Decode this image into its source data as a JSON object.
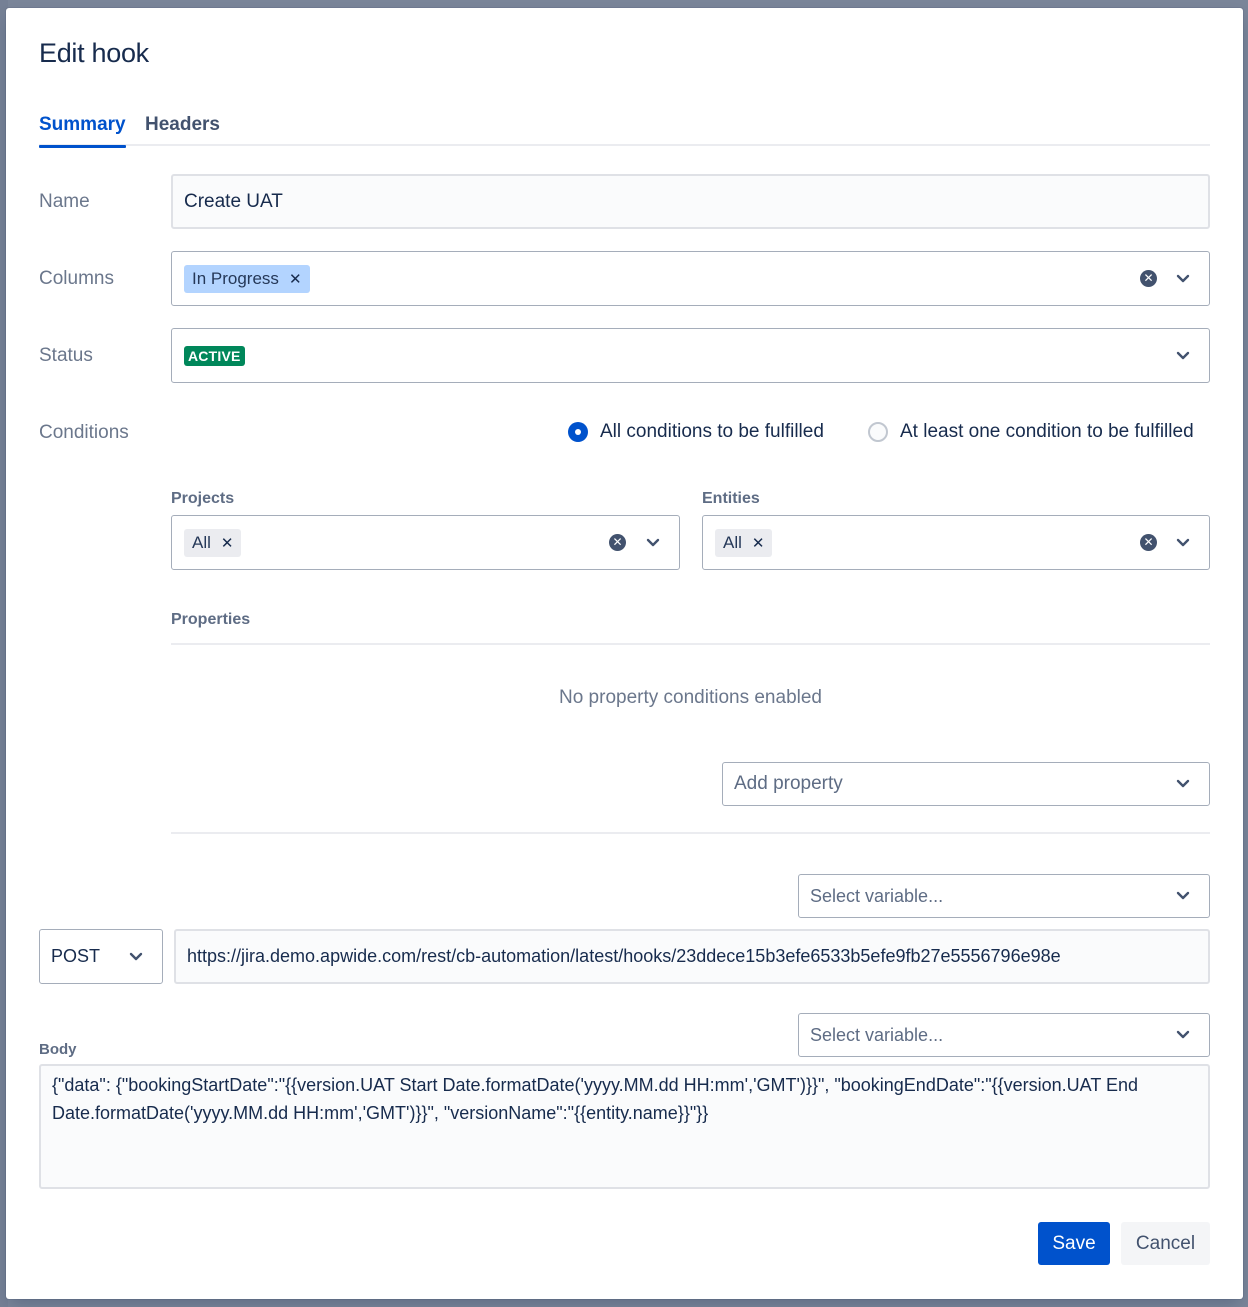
{
  "modal": {
    "title": "Edit hook"
  },
  "tabs": [
    {
      "label": "Summary",
      "active": true
    },
    {
      "label": "Headers",
      "active": false
    }
  ],
  "form": {
    "name": {
      "label": "Name",
      "value": "Create UAT"
    },
    "columns": {
      "label": "Columns",
      "chips": [
        "In Progress"
      ]
    },
    "status": {
      "label": "Status",
      "value": "ACTIVE",
      "color": "#00875a"
    },
    "conditions": {
      "label": "Conditions",
      "options": [
        {
          "label": "All conditions to be fulfilled",
          "checked": true
        },
        {
          "label": "At least one condition to be fulfilled",
          "checked": false
        }
      ],
      "projects": {
        "label": "Projects",
        "chips": [
          "All"
        ]
      },
      "entities": {
        "label": "Entities",
        "chips": [
          "All"
        ]
      },
      "properties": {
        "label": "Properties",
        "empty_text": "No property conditions enabled",
        "add_placeholder": "Add property"
      }
    },
    "request": {
      "variable_placeholder": "Select variable...",
      "method": "POST",
      "url": "https://jira.demo.apwide.com/rest/cb-automation/latest/hooks/23ddece15b3efe6533b5efe9fb27e5556796e98e"
    },
    "body": {
      "label": "Body",
      "variable_placeholder": "Select variable...",
      "value": "{\"data\": {\"bookingStartDate\":\"{{version.UAT Start Date.formatDate('yyyy.MM.dd HH:mm','GMT')}}\", \"bookingEndDate\":\"{{version.UAT End Date.formatDate('yyyy.MM.dd HH:mm','GMT')}}\", \"versionName\":\"{{entity.name}}\"}}"
    }
  },
  "actions": {
    "save": "Save",
    "cancel": "Cancel"
  },
  "colors": {
    "primary": "#0052cc",
    "success": "#00875a",
    "chip_selected": "#b3d4ff"
  }
}
